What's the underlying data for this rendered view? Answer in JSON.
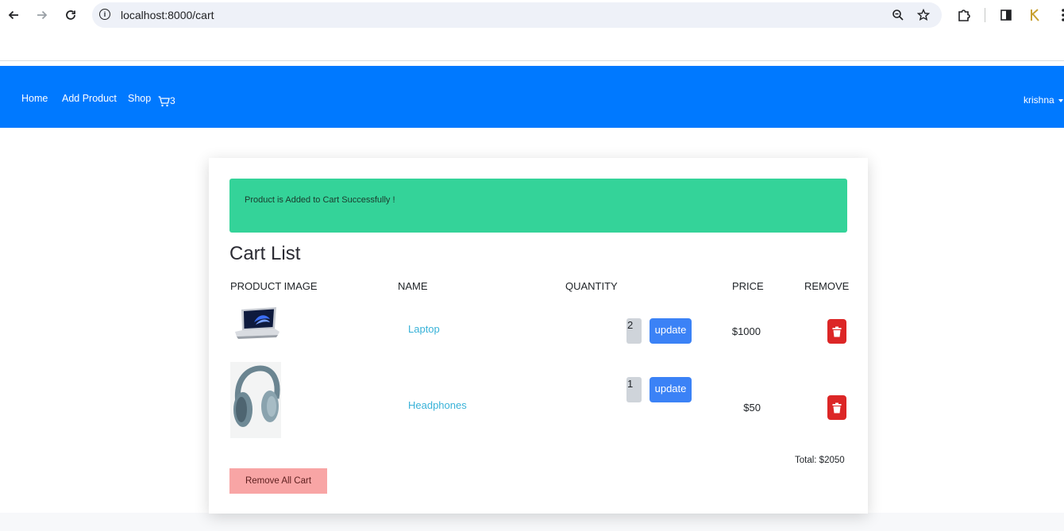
{
  "browser": {
    "url": "localhost:8000/cart"
  },
  "nav": {
    "links": [
      "Home",
      "Add Product",
      "Shop"
    ],
    "cart_count": "3",
    "user": "krishna"
  },
  "alert": {
    "message": "Product is Added to Cart Successfully !"
  },
  "cart": {
    "title": "Cart List",
    "headers": [
      "PRODUCT IMAGE",
      "NAME",
      "QUANTITY",
      "PRICE",
      "REMOVE"
    ],
    "items": [
      {
        "name": "Laptop",
        "quantity": "2",
        "update_label": "update",
        "price": "$1000"
      },
      {
        "name": "Headphones",
        "quantity": "1",
        "update_label": "update",
        "price": "$50"
      }
    ],
    "total": "Total: $2050",
    "remove_all_label": "Remove All Cart"
  },
  "colors": {
    "navbar": "#0079ff",
    "alert": "#34d399",
    "update_button": "#3b82f6",
    "remove_button": "#dc2626",
    "remove_all_button": "#f8a5a5",
    "product_link": "#38b2d8"
  },
  "icons": [
    "back-arrow-icon",
    "forward-arrow-icon",
    "reload-icon",
    "info-icon",
    "zoom-icon",
    "star-icon",
    "extensions-icon",
    "side-panel-icon",
    "profile-icon",
    "more-icon",
    "cart-icon",
    "trash-icon"
  ]
}
